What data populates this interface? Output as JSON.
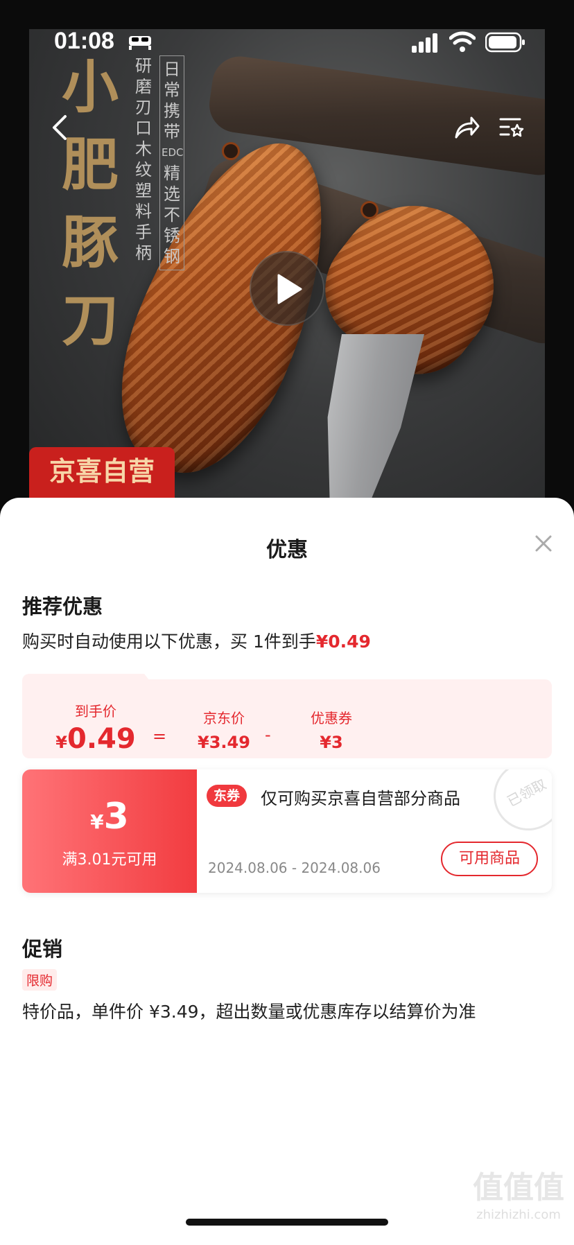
{
  "status_bar": {
    "time": "01:08"
  },
  "hero": {
    "title_chars": [
      "小",
      "肥",
      "豚",
      "刀"
    ],
    "sub1_chars": [
      "研",
      "磨",
      "刃",
      "口",
      "木",
      "纹",
      "塑",
      "料",
      "手",
      "柄"
    ],
    "sub2_chars": [
      "日",
      "常",
      "携",
      "带",
      "EDC",
      "精",
      "选",
      "不",
      "锈",
      "钢"
    ],
    "badge": "京喜自营"
  },
  "sheet": {
    "title": "优惠",
    "recommend": {
      "title": "推荐优惠",
      "desc_prefix": "购买时自动使用以下优惠，买 1件到手",
      "desc_price": "¥0.49"
    },
    "price_breakdown": {
      "final_label": "到手价",
      "final_currency": "¥",
      "final_value": "0.49",
      "equals": "=",
      "jd_label": "京东价",
      "jd_value": "¥3.49",
      "minus": "-",
      "coupon_label": "优惠券",
      "coupon_value": "¥3"
    },
    "coupon": {
      "currency": "¥",
      "amount": "3",
      "condition": "满3.01元可用",
      "tag": "东券",
      "name": "仅可购买京喜自营部分商品",
      "date": "2024.08.06 - 2024.08.06",
      "button": "可用商品",
      "stamp": "已领取"
    },
    "promotion": {
      "title": "促销",
      "tag": "限购",
      "desc": "特价品，单件价 ¥3.49，超出数量或优惠库存以结算价为准"
    }
  },
  "watermark": {
    "mark": "值值值",
    "site": "zhizhizhi.com"
  }
}
